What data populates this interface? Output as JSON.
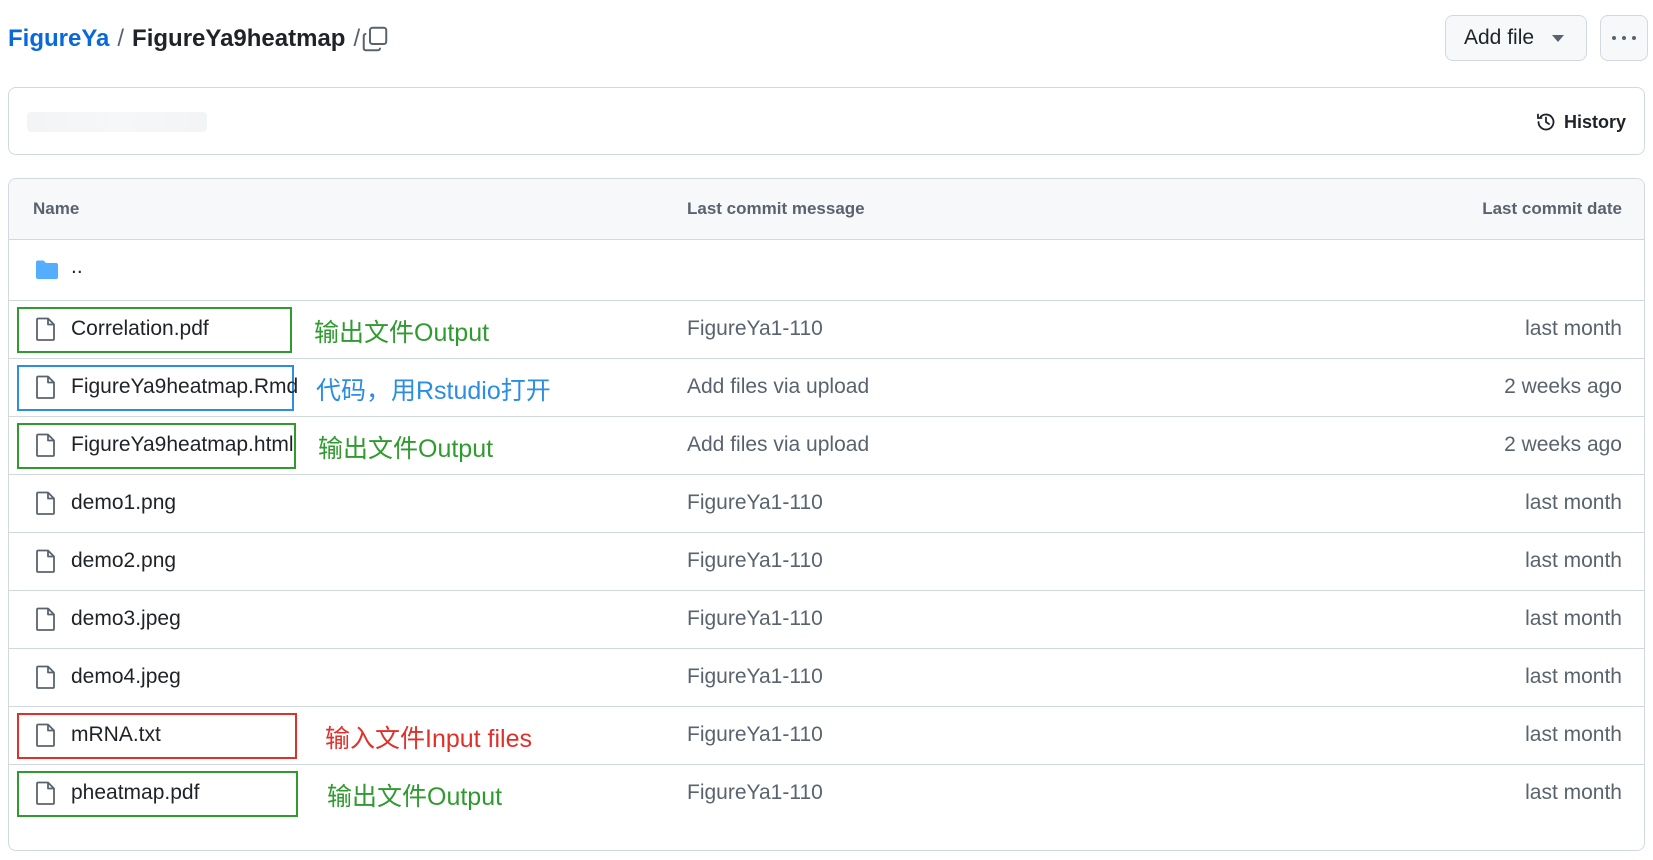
{
  "breadcrumb": {
    "repo": "FigureYa",
    "separator": "/",
    "directory": "FigureYa9heatmap",
    "trailing_separator": "/"
  },
  "toolbar": {
    "add_file_label": "Add file",
    "copy_icon": "copy-icon",
    "more_icon": "kebab-horizontal-icon"
  },
  "commit_bar": {
    "history_label": "History"
  },
  "table": {
    "headers": {
      "name": "Name",
      "message": "Last commit message",
      "date": "Last commit date"
    },
    "parent_dir": "..",
    "rows": [
      {
        "name": "Correlation.pdf",
        "message": "FigureYa1-110",
        "date": "last month",
        "note": "输出文件Output",
        "note_color": "#2f9b2f"
      },
      {
        "name": "FigureYa9heatmap.Rmd",
        "message": "Add files via upload",
        "date": "2 weeks ago",
        "note": "代码，用Rstudio打开",
        "note_color": "#2b8ee0"
      },
      {
        "name": "FigureYa9heatmap.html",
        "message": "Add files via upload",
        "date": "2 weeks ago",
        "note": "输出文件Output",
        "note_color": "#2f9b2f"
      },
      {
        "name": "demo1.png",
        "message": "FigureYa1-110",
        "date": "last month"
      },
      {
        "name": "demo2.png",
        "message": "FigureYa1-110",
        "date": "last month"
      },
      {
        "name": "demo3.jpeg",
        "message": "FigureYa1-110",
        "date": "last month"
      },
      {
        "name": "demo4.jpeg",
        "message": "FigureYa1-110",
        "date": "last month"
      },
      {
        "name": "mRNA.txt",
        "message": "FigureYa1-110",
        "date": "last month",
        "note": "输入文件Input files",
        "note_color": "#e0302a"
      },
      {
        "name": "pheatmap.pdf",
        "message": "FigureYa1-110",
        "date": "last month",
        "note": "输出文件Output",
        "note_color": "#2f9b2f"
      }
    ]
  },
  "colors": {
    "link": "#0969da",
    "folder": "#54aeff",
    "output_annotation": "#2f9b2f",
    "code_annotation": "#2b8ee0",
    "input_annotation": "#e0302a"
  }
}
